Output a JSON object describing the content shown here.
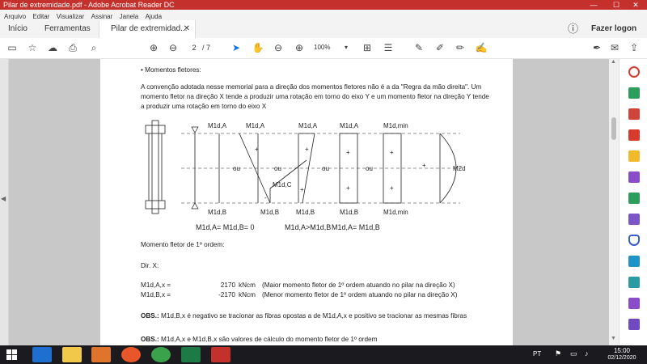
{
  "window": {
    "title": "Pilar de extremidade.pdf - Adobe Acrobat Reader DC"
  },
  "menu": [
    "Arquivo",
    "Editar",
    "Visualizar",
    "Assinar",
    "Janela",
    "Ajuda"
  ],
  "tabs": {
    "home": "Início",
    "tools": "Ferramentas",
    "document": "Pilar de extremidad...",
    "signin": "Fazer logon"
  },
  "toolbar": {
    "page_current": "2",
    "page_total": "/ 7",
    "zoom": "100%"
  },
  "doc": {
    "bullet": "• Momentos fletores:",
    "para1": "A convenção adotada nesse memorial para a direção dos momentos fletores não é a da \"Regra da mão direita\". Um",
    "para2": "momento fletor na direção X tende a produzir uma rotação em torno do eixo Y e um momento fletor na direção Y tende",
    "para3": "a produzir uma rotação em torno do eixo X",
    "diagram": {
      "labels_top": [
        "M1d,A",
        "M1d,A",
        "M1d,A",
        "M1d,A",
        "M1d,min"
      ],
      "labels_bottom": [
        "M1d,B",
        "M1d,B",
        "M1d,B",
        "M1d,B",
        "M1d,min"
      ],
      "m1dc": "M1d,C",
      "m2d": "M2d",
      "ou": "ou",
      "plus": "+",
      "minus": "-",
      "eq1": "M1d,A= M1d,B= 0",
      "eq2": "M1d,A>M1d,B",
      "eq3": "M1d,A= M1d,B"
    },
    "heading_1st": "Momento fletor de 1º ordem:",
    "dir": "Dir. X:",
    "rows": [
      {
        "label": "M1d,A,x =",
        "value": "2170",
        "unit": "kNcm",
        "desc": "(Maior momento fletor de 1º ordem atuando no pilar na direção X)"
      },
      {
        "label": "M1d,B,x =",
        "value": "-2170",
        "unit": "kNcm",
        "desc": "(Menor momento fletor de 1º ordem atuando no pilar na direção X)"
      }
    ],
    "obs1_label": "OBS.:",
    "obs1_text": "M1d,B,x é negativo se tracionar as fibras opostas a de M1d,A,x e positivo se tracionar as mesmas fibras",
    "obs2_label": "OBS.:",
    "obs2_text": "M1d,A,x e M1d,B,x são valores de cálculo do momento fletor de 1º ordem"
  },
  "taskbar": {
    "lang": "PT",
    "time": "15:00",
    "date": "02/12/2020"
  },
  "colors": {
    "titlebar": "#c4302b",
    "accent": "#1473e6",
    "taskbar": "#1b1b1f"
  }
}
